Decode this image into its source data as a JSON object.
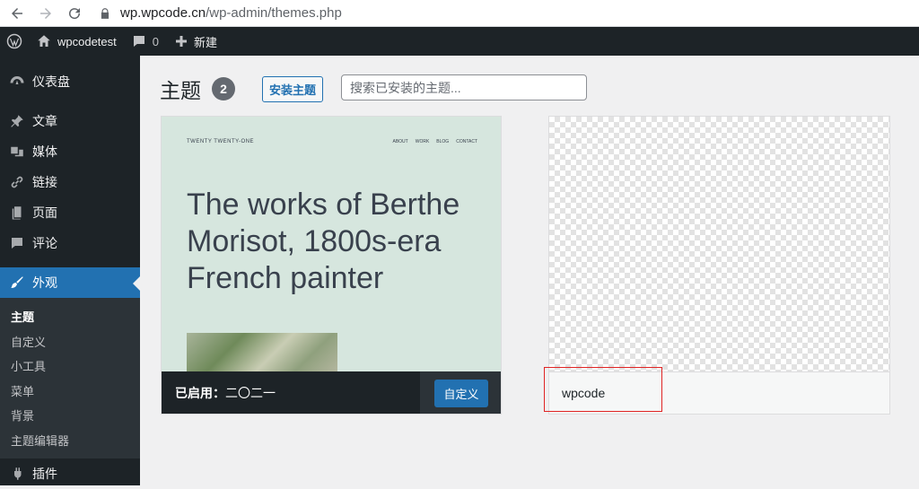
{
  "browser": {
    "url_host": "wp.wpcode.cn",
    "url_path": "/wp-admin/themes.php"
  },
  "adminbar": {
    "site_name": "wpcodetest",
    "comment_count": "0",
    "new_label": "新建"
  },
  "sidebar": {
    "items": [
      {
        "label": "仪表盘",
        "icon": "dashboard-icon"
      },
      {
        "label": "文章",
        "icon": "pin-icon"
      },
      {
        "label": "媒体",
        "icon": "media-icon"
      },
      {
        "label": "链接",
        "icon": "link-icon"
      },
      {
        "label": "页面",
        "icon": "page-icon"
      },
      {
        "label": "评论",
        "icon": "comment-icon"
      },
      {
        "label": "外观",
        "icon": "brush-icon"
      },
      {
        "label": "插件",
        "icon": "plugin-icon"
      }
    ],
    "submenu": [
      "主题",
      "自定义",
      "小工具",
      "菜单",
      "背景",
      "主题编辑器"
    ]
  },
  "main": {
    "title": "主题",
    "theme_count": "2",
    "add_button": "安装主题",
    "search_placeholder": "搜索已安装的主题..."
  },
  "themes": [
    {
      "screenshot_header": "TWENTY TWENTY-ONE",
      "screenshot_nav": [
        "ABOUT",
        "WORK",
        "BLOG",
        "CONTACT"
      ],
      "screenshot_heading": "The works of Berthe Morisot, 1800s-era French painter",
      "active_prefix": "已启用：",
      "name": "二〇二一",
      "customize_label": "自定义"
    },
    {
      "name": "wpcode"
    }
  ],
  "colors": {
    "admin_dark": "#1d2327",
    "accent_blue": "#2271b1",
    "highlight_red": "#e02424"
  }
}
